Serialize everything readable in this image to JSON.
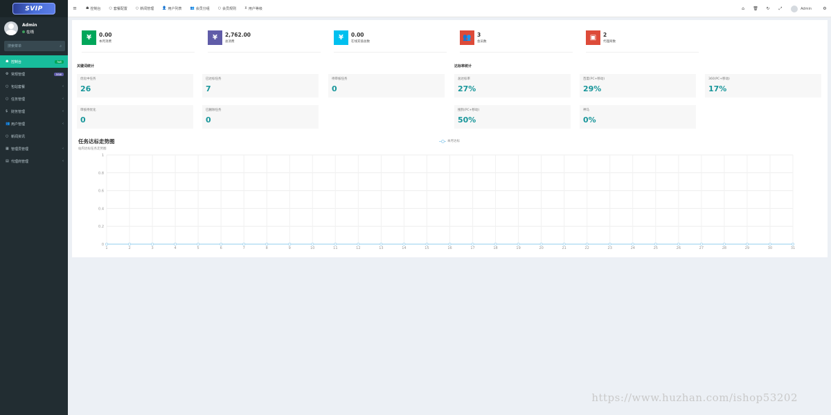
{
  "sidebar": {
    "logo_text": "SVIP",
    "user": {
      "name": "Admin",
      "status": "在线"
    },
    "search_placeholder": "搜索菜单",
    "items": [
      {
        "icon": "dashboard-icon",
        "glyph": "☗",
        "label": "控制台",
        "badge": "hot",
        "badge_color": "#00a65a",
        "active": true
      },
      {
        "icon": "cogs-icon",
        "glyph": "⚙",
        "label": "常规管理",
        "badge": "new",
        "badge_color": "#605ca8"
      },
      {
        "icon": "circle-icon",
        "glyph": "○",
        "label": "包站套餐",
        "arrow": "‹"
      },
      {
        "icon": "circle-icon",
        "glyph": "○",
        "label": "任务管理",
        "arrow": "‹"
      },
      {
        "icon": "dollar-icon",
        "glyph": "$",
        "label": "财务管理",
        "arrow": "‹"
      },
      {
        "icon": "users-icon",
        "glyph": "👥",
        "label": "用户管理",
        "arrow": "‹"
      },
      {
        "icon": "circle-icon",
        "glyph": "○",
        "label": "新闻资讯"
      },
      {
        "icon": "list-icon",
        "glyph": "▦",
        "label": "管理员管理",
        "arrow": "‹"
      },
      {
        "icon": "list-icon",
        "glyph": "▤",
        "label": "代理商管理",
        "arrow": "‹"
      }
    ]
  },
  "topnav": {
    "tabs": [
      {
        "icon": "dashboard-icon",
        "glyph": "☗",
        "label": "控制台"
      },
      {
        "icon": "circle-icon",
        "glyph": "○",
        "label": "套餐配置"
      },
      {
        "icon": "circle-icon",
        "glyph": "○",
        "label": "新闻管理"
      },
      {
        "icon": "user-icon",
        "glyph": "👤",
        "label": "用户列表"
      },
      {
        "icon": "users-icon",
        "glyph": "👥",
        "label": "会员分组"
      },
      {
        "icon": "circle-icon",
        "glyph": "○",
        "label": "会员规则"
      },
      {
        "icon": "share-icon",
        "glyph": "⊻",
        "label": "用户等级"
      }
    ],
    "tools": [
      {
        "icon": "home-icon",
        "glyph": "⌂"
      },
      {
        "icon": "trash-icon",
        "glyph": "🗑"
      },
      {
        "icon": "refresh-icon",
        "glyph": "↻"
      },
      {
        "icon": "fullscreen-icon",
        "glyph": "⤢"
      }
    ],
    "admin_label": "Admin",
    "settings_glyph": "⚙"
  },
  "stats": [
    {
      "value": "0.00",
      "label": "本月消费",
      "color": "#00a65a",
      "glyph": "¥"
    },
    {
      "value": "2,762.00",
      "label": "总消费",
      "color": "#605ca8",
      "glyph": "¥"
    },
    {
      "value": "0.00",
      "label": "在线充值总数",
      "color": "#00c0ef",
      "glyph": "¥"
    },
    {
      "value": "3",
      "label": "会员数",
      "color": "#dd4b39",
      "glyph": "👥"
    },
    {
      "value": "2",
      "label": "代理商数",
      "color": "#dd4b39",
      "glyph": "▣"
    }
  ],
  "keyword_section": {
    "title": "关键词统计",
    "cards": [
      {
        "label": "优化中任务",
        "value": "26"
      },
      {
        "label": "已达标任务",
        "value": "7"
      },
      {
        "label": "待审核任务",
        "value": "0"
      },
      {
        "label": "审核待优化",
        "value": "0"
      },
      {
        "label": "已删除任务",
        "value": "0"
      }
    ]
  },
  "rate_section": {
    "title": "达标率统计",
    "cards": [
      {
        "label": "总达标率",
        "value": "27%"
      },
      {
        "label": "百度(PC+移动)",
        "value": "29%"
      },
      {
        "label": "360(PC+移动)",
        "value": "17%"
      },
      {
        "label": "搜狗(PC+移动)",
        "value": "50%"
      },
      {
        "label": "神马",
        "value": "0%"
      }
    ]
  },
  "chart_data": {
    "type": "line",
    "title": "任务达标走势图",
    "subtitle": "站内达标任务走势图",
    "x": [
      "1",
      "2",
      "3",
      "4",
      "5",
      "6",
      "7",
      "8",
      "9",
      "10",
      "11",
      "12",
      "13",
      "14",
      "15",
      "16",
      "17",
      "18",
      "19",
      "20",
      "21",
      "22",
      "23",
      "24",
      "25",
      "26",
      "27",
      "28",
      "29",
      "30",
      "31"
    ],
    "series": [
      {
        "name": "本月达标",
        "color": "#a6d6f0",
        "values": [
          0,
          0,
          0,
          0,
          0,
          0,
          0,
          0,
          0,
          0,
          0,
          0,
          0,
          0,
          0,
          0,
          0,
          0,
          0,
          0,
          0,
          0,
          0,
          0,
          0,
          0,
          0,
          0,
          0,
          0,
          0
        ]
      }
    ],
    "y_ticks": [
      "0",
      "0.2",
      "0.4",
      "0.6",
      "0.8",
      "1"
    ],
    "ylim": [
      0,
      1
    ],
    "grid": true,
    "legend": "top-center"
  },
  "watermark": "https://www.huzhan.com/ishop53202"
}
